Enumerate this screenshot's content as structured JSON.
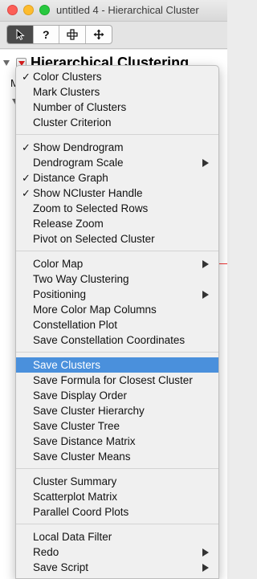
{
  "window": {
    "title": "untitled 4 - Hierarchical Cluster"
  },
  "toolbar": {
    "tools": [
      {
        "name": "arrow-tool-icon",
        "active": true
      },
      {
        "name": "help-tool-icon",
        "glyph": "?"
      },
      {
        "name": "crosshair-tool-icon"
      },
      {
        "name": "grabber-tool-icon"
      }
    ]
  },
  "report": {
    "heading": "Hierarchical Clustering",
    "sub": "M"
  },
  "menu": {
    "highlight_color": "#4a90dc",
    "groups": [
      [
        {
          "label": "Color Clusters",
          "checked": true
        },
        {
          "label": "Mark Clusters"
        },
        {
          "label": "Number of Clusters"
        },
        {
          "label": "Cluster Criterion"
        }
      ],
      [
        {
          "label": "Show Dendrogram",
          "checked": true
        },
        {
          "label": "Dendrogram Scale",
          "submenu": true
        },
        {
          "label": "Distance Graph",
          "checked": true
        },
        {
          "label": "Show NCluster Handle",
          "checked": true
        },
        {
          "label": "Zoom to Selected Rows"
        },
        {
          "label": "Release Zoom"
        },
        {
          "label": "Pivot on Selected Cluster"
        }
      ],
      [
        {
          "label": "Color Map",
          "submenu": true
        },
        {
          "label": "Two Way Clustering"
        },
        {
          "label": "Positioning",
          "submenu": true
        },
        {
          "label": "More Color Map Columns"
        },
        {
          "label": "Constellation Plot"
        },
        {
          "label": "Save Constellation Coordinates"
        }
      ],
      [
        {
          "label": "Save Clusters",
          "highlighted": true
        },
        {
          "label": "Save Formula for Closest Cluster"
        },
        {
          "label": "Save Display Order"
        },
        {
          "label": "Save Cluster Hierarchy"
        },
        {
          "label": "Save Cluster Tree"
        },
        {
          "label": "Save Distance Matrix"
        },
        {
          "label": "Save Cluster Means"
        }
      ],
      [
        {
          "label": "Cluster Summary"
        },
        {
          "label": "Scatterplot Matrix"
        },
        {
          "label": "Parallel Coord Plots"
        }
      ],
      [
        {
          "label": "Local Data Filter"
        },
        {
          "label": "Redo",
          "submenu": true
        },
        {
          "label": "Save Script",
          "submenu": true
        }
      ]
    ]
  }
}
